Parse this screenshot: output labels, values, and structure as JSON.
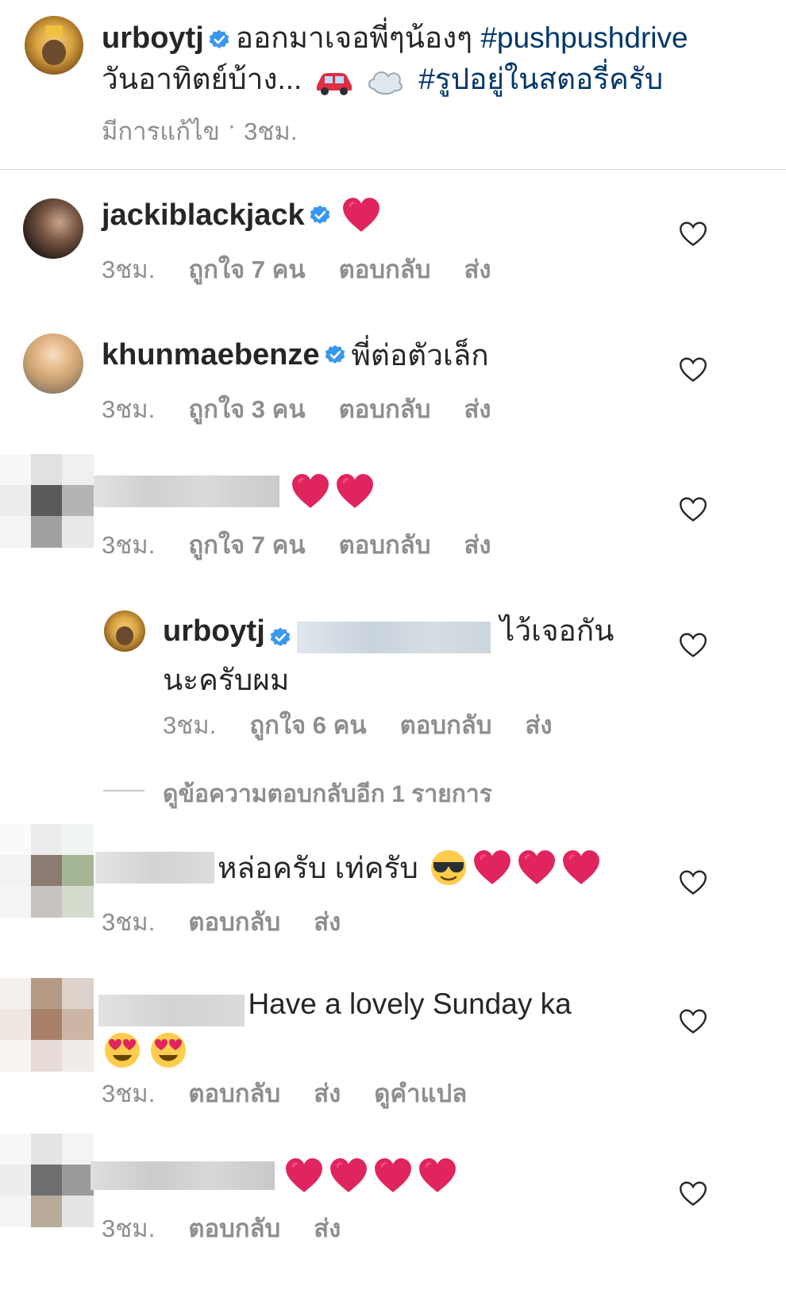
{
  "post": {
    "username": "urboytj",
    "caption_part1": "ออกมาเจอพี่ๆน้องๆ",
    "hashtag1": "#pushpushdrive",
    "caption_part2": "วันอาทิตย์บ้าง...",
    "hashtag2": "#รูปอยู่ในสตอรี่ครับ",
    "edited": "มีการแก้ไข",
    "dot": "·",
    "time": "3ชม."
  },
  "comments": [
    {
      "username": "jackiblackjack",
      "text": "",
      "time": "3ชม.",
      "likes": "ถูกใจ 7 คน",
      "reply": "ตอบกลับ",
      "send": "ส่ง"
    },
    {
      "username": "khunmaebenze",
      "text": "พี่ต่อตัวเล็ก",
      "time": "3ชม.",
      "likes": "ถูกใจ 3 คน",
      "reply": "ตอบกลับ",
      "send": "ส่ง"
    },
    {
      "username": "",
      "text": "",
      "time": "3ชม.",
      "likes": "ถูกใจ 7 คน",
      "reply": "ตอบกลับ",
      "send": "ส่ง"
    },
    {
      "username": "",
      "text": "หล่อครับ เท่ครับ",
      "time": "3ชม.",
      "reply": "ตอบกลับ",
      "send": "ส่ง"
    },
    {
      "username": "",
      "text": "Have a lovely Sunday ka",
      "time": "3ชม.",
      "reply": "ตอบกลับ",
      "send": "ส่ง",
      "translate": "ดูคำแปล"
    },
    {
      "username": "",
      "text": "",
      "time": "3ชม.",
      "reply": "ตอบกลับ",
      "send": "ส่ง"
    }
  ],
  "reply": {
    "username": "urboytj",
    "text1": "ไว้เจอกัน",
    "text2": "นะครับผม",
    "time": "3ชม.",
    "likes": "ถูกใจ 6 คน",
    "reply": "ตอบกลับ",
    "send": "ส่ง"
  },
  "view_more_replies": "ดูข้อความตอบกลับอีก 1 รายการ",
  "colors": {
    "link": "#00376b",
    "verified": "#3897f0",
    "heart": "#e0245e",
    "meta": "#8e8e8e"
  },
  "icons": [
    "verified-badge-icon",
    "heart-outline-icon",
    "red-heart-emoji",
    "car-emoji",
    "dash-emoji",
    "sunglasses-emoji",
    "heart-eyes-emoji"
  ]
}
